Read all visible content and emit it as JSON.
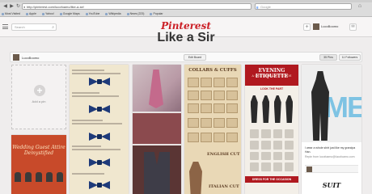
{
  "browser": {
    "url": "http://pinterest.com/lucofoamo/like-a-sir/",
    "search_placeholder": "Google",
    "bookmarks": [
      "Most Visited",
      "Apple",
      "Yahoo!",
      "Google Maps",
      "YouTube",
      "Wikipedia",
      "News (223)",
      "Popular"
    ]
  },
  "header": {
    "search_placeholder": "Search",
    "logo": "Pinterest",
    "username": "LucoBoomo"
  },
  "board": {
    "title": "Like a Sir",
    "owner": "LucoBoomo",
    "edit_label": "Edit Board",
    "pins_label": "35 Pins",
    "followers_label": "11 Followers",
    "add_pin_label": "Add a pin"
  },
  "pins": {
    "wedding": "Wedding Guest Attire Demystified",
    "collars": "COLLARS & CUFFS",
    "english_cut": "ENGLISH CUT",
    "italian_cut": "ITALIAN CUT",
    "etiquette_title": "EVENING ETIQUETTE",
    "etiquette_sub": "A GENTLEMAN'S GUIDE",
    "etiquette_look": "LOOK THE PART",
    "etiquette_dress": "DRESS FOR THE OCCASION",
    "hansolo_desc": "I wear a whole shirt just like my grandpa Han.",
    "hansolo_source": "Repin from\nlucofoamo@lucofoamo.com",
    "suit_yourself": "SUIT YOURSELF"
  },
  "colors": {
    "pinterest_red": "#cb2027",
    "background": "#efeded"
  }
}
